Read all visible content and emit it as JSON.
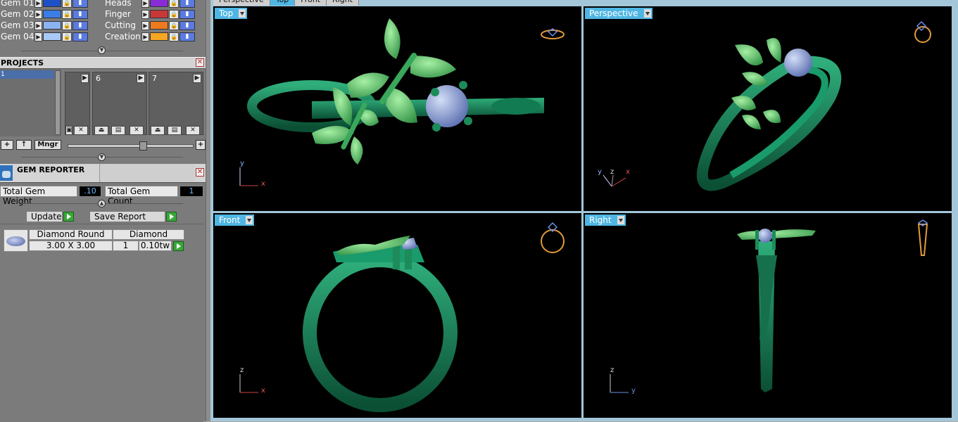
{
  "layers": {
    "left": [
      {
        "name": "Gem 01",
        "color": "#1e50c8"
      },
      {
        "name": "Gem 02",
        "color": "#3b7de6"
      },
      {
        "name": "Gem 03",
        "color": "#8ab4f2"
      },
      {
        "name": "Gem 04",
        "color": "#a9c8f5"
      }
    ],
    "right": [
      {
        "name": "Heads",
        "color": "#8a2bd8"
      },
      {
        "name": "Finger",
        "color": "#c83838"
      },
      {
        "name": "Cutting",
        "color": "#f07a1e"
      },
      {
        "name": "Creation",
        "color": "#f5a623"
      }
    ]
  },
  "projects": {
    "title": "PROJECTS",
    "list_item": "1",
    "thumbs": [
      "6",
      "7"
    ],
    "mngr_label": "Mngr"
  },
  "gem_reporter": {
    "title": "GEM REPORTER",
    "total_weight_label": "Total Gem Weight",
    "total_weight_value": ".10",
    "total_count_label": "Total Gem Count",
    "total_count_value": "1",
    "update_label": "Update",
    "save_report_label": "Save Report",
    "gem": {
      "shape": "Diamond Round",
      "material": "Diamond",
      "size": "3.00 X 3.00",
      "count": "1",
      "weight": "0.10tw"
    }
  },
  "tabs": [
    "Perspective",
    "Top",
    "Front",
    "Right"
  ],
  "viewports": {
    "top": {
      "label": "Top",
      "axis_v": "y",
      "axis_h": "x"
    },
    "perspective": {
      "label": "Perspective",
      "axis_y": "y",
      "axis_z": "z",
      "axis_x": "x"
    },
    "front": {
      "label": "Front",
      "axis_v": "z",
      "axis_h": "x"
    },
    "right": {
      "label": "Right",
      "axis_v": "z",
      "axis_h": "y"
    }
  },
  "colors": {
    "ring_green": "#1e8f62",
    "leaf_green": "#55c46a",
    "gem_blue": "#7f96d8",
    "viewport_bg": "#000000",
    "label_blue": "#4fb6e3"
  }
}
